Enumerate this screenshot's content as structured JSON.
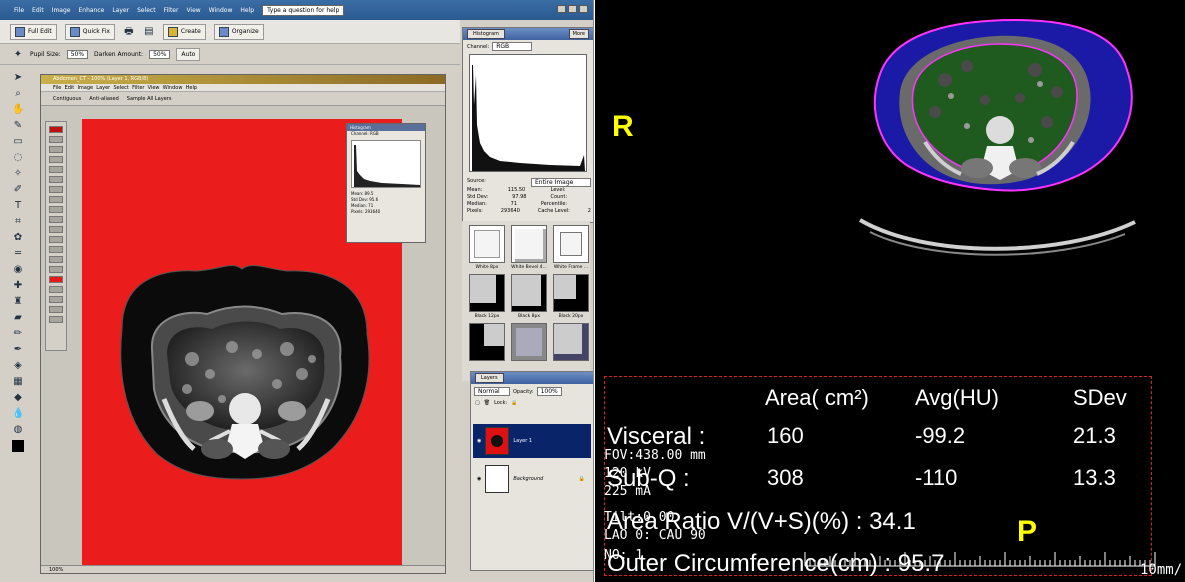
{
  "photoshop": {
    "menu": [
      "File",
      "Edit",
      "Image",
      "Enhance",
      "Layer",
      "Select",
      "Filter",
      "View",
      "Window",
      "Help"
    ],
    "help_field": "Type a question for help",
    "toolbar": {
      "full_edit": "Full Edit",
      "quick_fix": "Quick Fix",
      "create": "Create",
      "organize": "Organize"
    },
    "options_bar": {
      "pupil_size_label": "Pupil Size:",
      "pupil_size_value": "50%",
      "darken_label": "Darken Amount:",
      "darken_value": "50%",
      "auto_label": "Auto"
    },
    "document": {
      "title": "Abdomen_CT - 100% (Layer 1, RGB/8)",
      "menu": [
        "File",
        "Edit",
        "Image",
        "Layer",
        "Select",
        "Filter",
        "View",
        "Window",
        "Help"
      ],
      "options": [
        "Contiguous",
        "Anti-aliased",
        "Sample All Layers"
      ],
      "status": "100%"
    },
    "mini_histogram": {
      "title": "Histogram",
      "channel": "Channel: RGB",
      "rows": [
        "Mean: 89.5",
        "Std Dev: 95.6",
        "Median: 71",
        "Pixels: 293640"
      ]
    },
    "histogram_panel": {
      "tab": "Histogram",
      "more": "More",
      "channel_label": "Channel:",
      "channel_value": "RGB",
      "source_label": "Source:",
      "source_value": "Entire Image",
      "stats": [
        [
          "Mean:",
          "115.50",
          "Level:",
          ""
        ],
        [
          "Std Dev:",
          "97.98",
          "Count:",
          ""
        ],
        [
          "Median:",
          "71",
          "Percentile:",
          ""
        ],
        [
          "Pixels:",
          "293640",
          "Cache Level:",
          "2"
        ]
      ]
    },
    "styles": [
      "White 8px",
      "White Bevel 4...",
      "White Frame ...",
      "Black 12px",
      "Black 8px",
      "Black 20px"
    ],
    "layers_panel": {
      "tab": "Layers",
      "blend_mode": "Normal",
      "opacity_label": "Opacity:",
      "opacity_value": "100%",
      "lock_label": "Lock:",
      "layers": [
        "Layer 1",
        "Background"
      ]
    }
  },
  "ct_viewer": {
    "orientation_right": "R",
    "orientation_posterior": "P",
    "table": {
      "headers": [
        "Area( cm²)",
        "Avg(HU)",
        "SDev"
      ],
      "rows": [
        {
          "label": "Visceral :",
          "area": "160",
          "avg": "-99.2",
          "sdev": "21.3"
        },
        {
          "label": "Sub-Q :",
          "area": "308",
          "avg": "-110",
          "sdev": "13.3"
        }
      ],
      "ratio": "Area Ratio V/(V+S)(%) : 34.1",
      "circumference": "Outer Circumference(cm) : 95.7"
    },
    "overlay": {
      "fov": "FOV:438.00 mm",
      "kv": "120 kV",
      "ma": "225 mA",
      "tilt": "Tilt:0.00",
      "lao": "LAO 0: CAU 90",
      "no": "NO: 1"
    },
    "scale_label": "10mm/"
  },
  "colors": {
    "canvas_red": "#ea1c1c",
    "visceral_fat": "#1f5a1f",
    "subq_fat": "#1a1aa6",
    "roi_contour": "#ff33ff",
    "orientation": "#ffff00",
    "roi_box": "#e02020"
  }
}
